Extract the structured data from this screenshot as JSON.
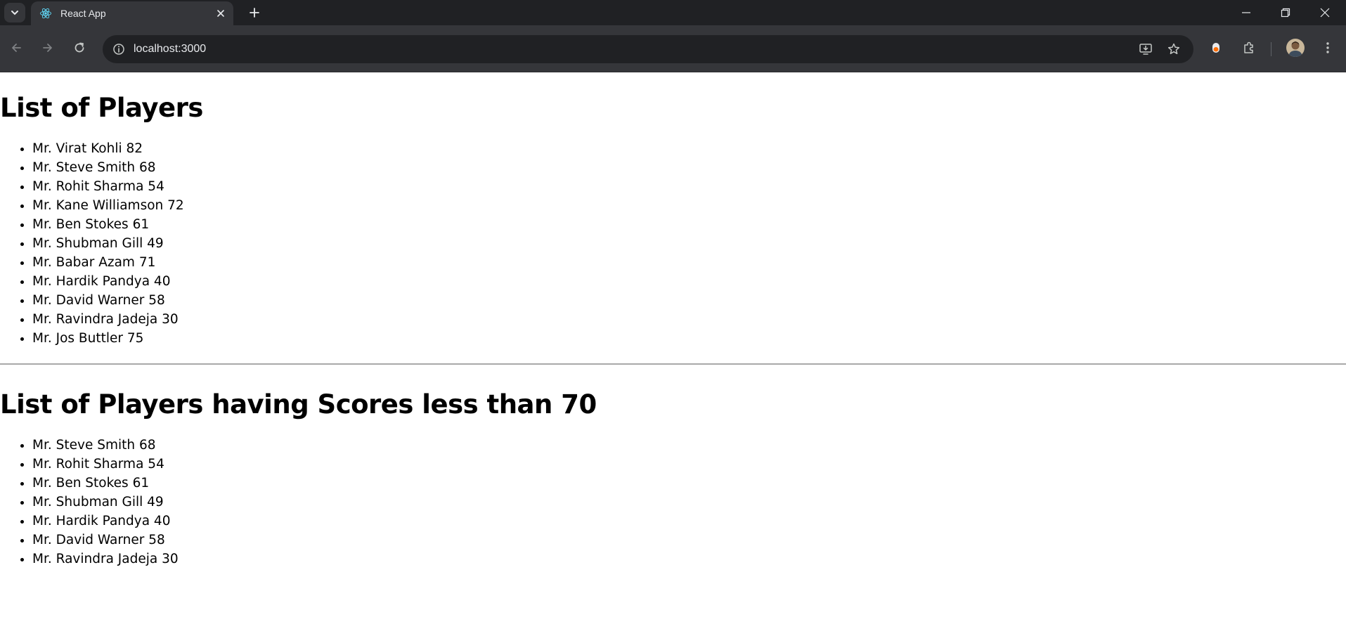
{
  "browser": {
    "tab_title": "React App",
    "url": "localhost:3000",
    "icons": {
      "tab_search": "chevron-down-icon",
      "favicon": "react-icon",
      "tab_close": "close-icon",
      "new_tab": "plus-icon",
      "minimize": "minimize-icon",
      "restore": "restore-icon",
      "close_window": "close-icon",
      "back": "back-arrow-icon",
      "forward": "forward-arrow-icon",
      "reload": "reload-icon",
      "site_info": "info-icon",
      "install": "install-app-icon",
      "bookmark": "star-icon",
      "extension_dot": "extension-icon",
      "extensions": "puzzle-icon",
      "profile": "avatar",
      "menu": "kebab-menu-icon"
    }
  },
  "page": {
    "heading_all": "List of Players",
    "players_all": [
      "Mr. Virat Kohli 82",
      "Mr. Steve Smith 68",
      "Mr. Rohit Sharma 54",
      "Mr. Kane Williamson 72",
      "Mr. Ben Stokes 61",
      "Mr. Shubman Gill 49",
      "Mr. Babar Azam 71",
      "Mr. Hardik Pandya 40",
      "Mr. David Warner 58",
      "Mr. Ravindra Jadeja 30",
      "Mr. Jos Buttler 75"
    ],
    "heading_filtered": "List of Players having Scores less than 70",
    "players_filtered": [
      "Mr. Steve Smith 68",
      "Mr. Rohit Sharma 54",
      "Mr. Ben Stokes 61",
      "Mr. Shubman Gill 49",
      "Mr. Hardik Pandya 40",
      "Mr. David Warner 58",
      "Mr. Ravindra Jadeja 30"
    ]
  },
  "colors": {
    "tabstrip_bg": "#202124",
    "toolbar_bg": "#35363a",
    "omnibox_bg": "#202124",
    "chrome_text": "#e8eaed",
    "chrome_icon": "#c4c7c5",
    "react_blue": "#61dafb",
    "page_bg": "#ffffff",
    "page_text": "#000000"
  }
}
